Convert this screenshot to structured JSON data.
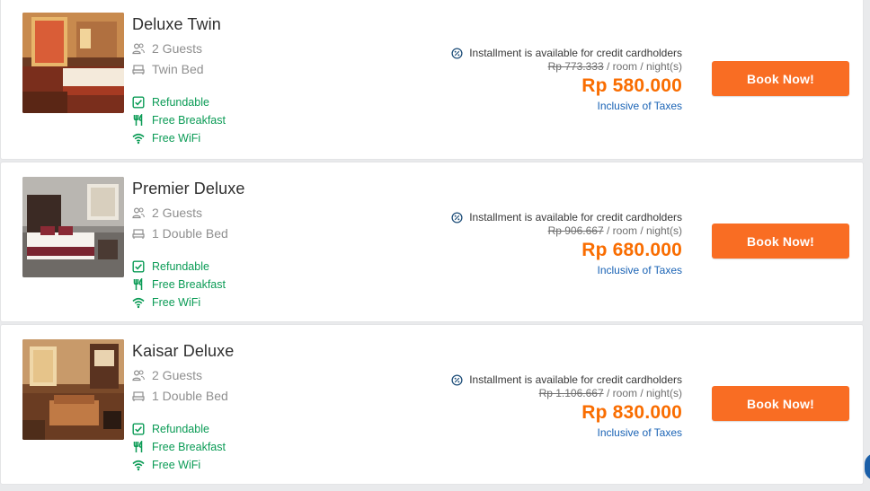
{
  "rooms": [
    {
      "name": "Deluxe Twin",
      "guests": "2 Guests",
      "bed": "Twin Bed",
      "perks": {
        "refundable": "Refundable",
        "breakfast": "Free Breakfast",
        "wifi": "Free WiFi"
      },
      "installment": "Installment is available for credit cardholders",
      "original_price": "Rp 773.333",
      "per_unit": " / room / night(s)",
      "price": "Rp 580.000",
      "tax_note": "Inclusive of Taxes",
      "cta": "Book Now!"
    },
    {
      "name": "Premier Deluxe",
      "guests": "2 Guests",
      "bed": "1 Double Bed",
      "perks": {
        "refundable": "Refundable",
        "breakfast": "Free Breakfast",
        "wifi": "Free WiFi"
      },
      "installment": "Installment is available for credit cardholders",
      "original_price": "Rp 906.667",
      "per_unit": " / room / night(s)",
      "price": "Rp 680.000",
      "tax_note": "Inclusive of Taxes",
      "cta": "Book Now!"
    },
    {
      "name": "Kaisar Deluxe",
      "guests": "2 Guests",
      "bed": "1 Double Bed",
      "perks": {
        "refundable": "Refundable",
        "breakfast": "Free Breakfast",
        "wifi": "Free WiFi"
      },
      "installment": "Installment is available for credit cardholders",
      "original_price": "Rp 1.106.667",
      "per_unit": " / room / night(s)",
      "price": "Rp 830.000",
      "tax_note": "Inclusive of Taxes",
      "cta": "Book Now!"
    }
  ],
  "icons": {
    "guests": "guests-icon",
    "bed": "bed-icon",
    "refundable": "refundable-check-icon",
    "breakfast": "fork-knife-icon",
    "wifi": "wifi-icon",
    "installment": "percent-badge-icon"
  },
  "colors": {
    "price": "#f96d01",
    "button": "#f96d23",
    "perk": "#0a9b55",
    "tax_link": "#1a63b5",
    "muted": "#8f8f8f"
  }
}
